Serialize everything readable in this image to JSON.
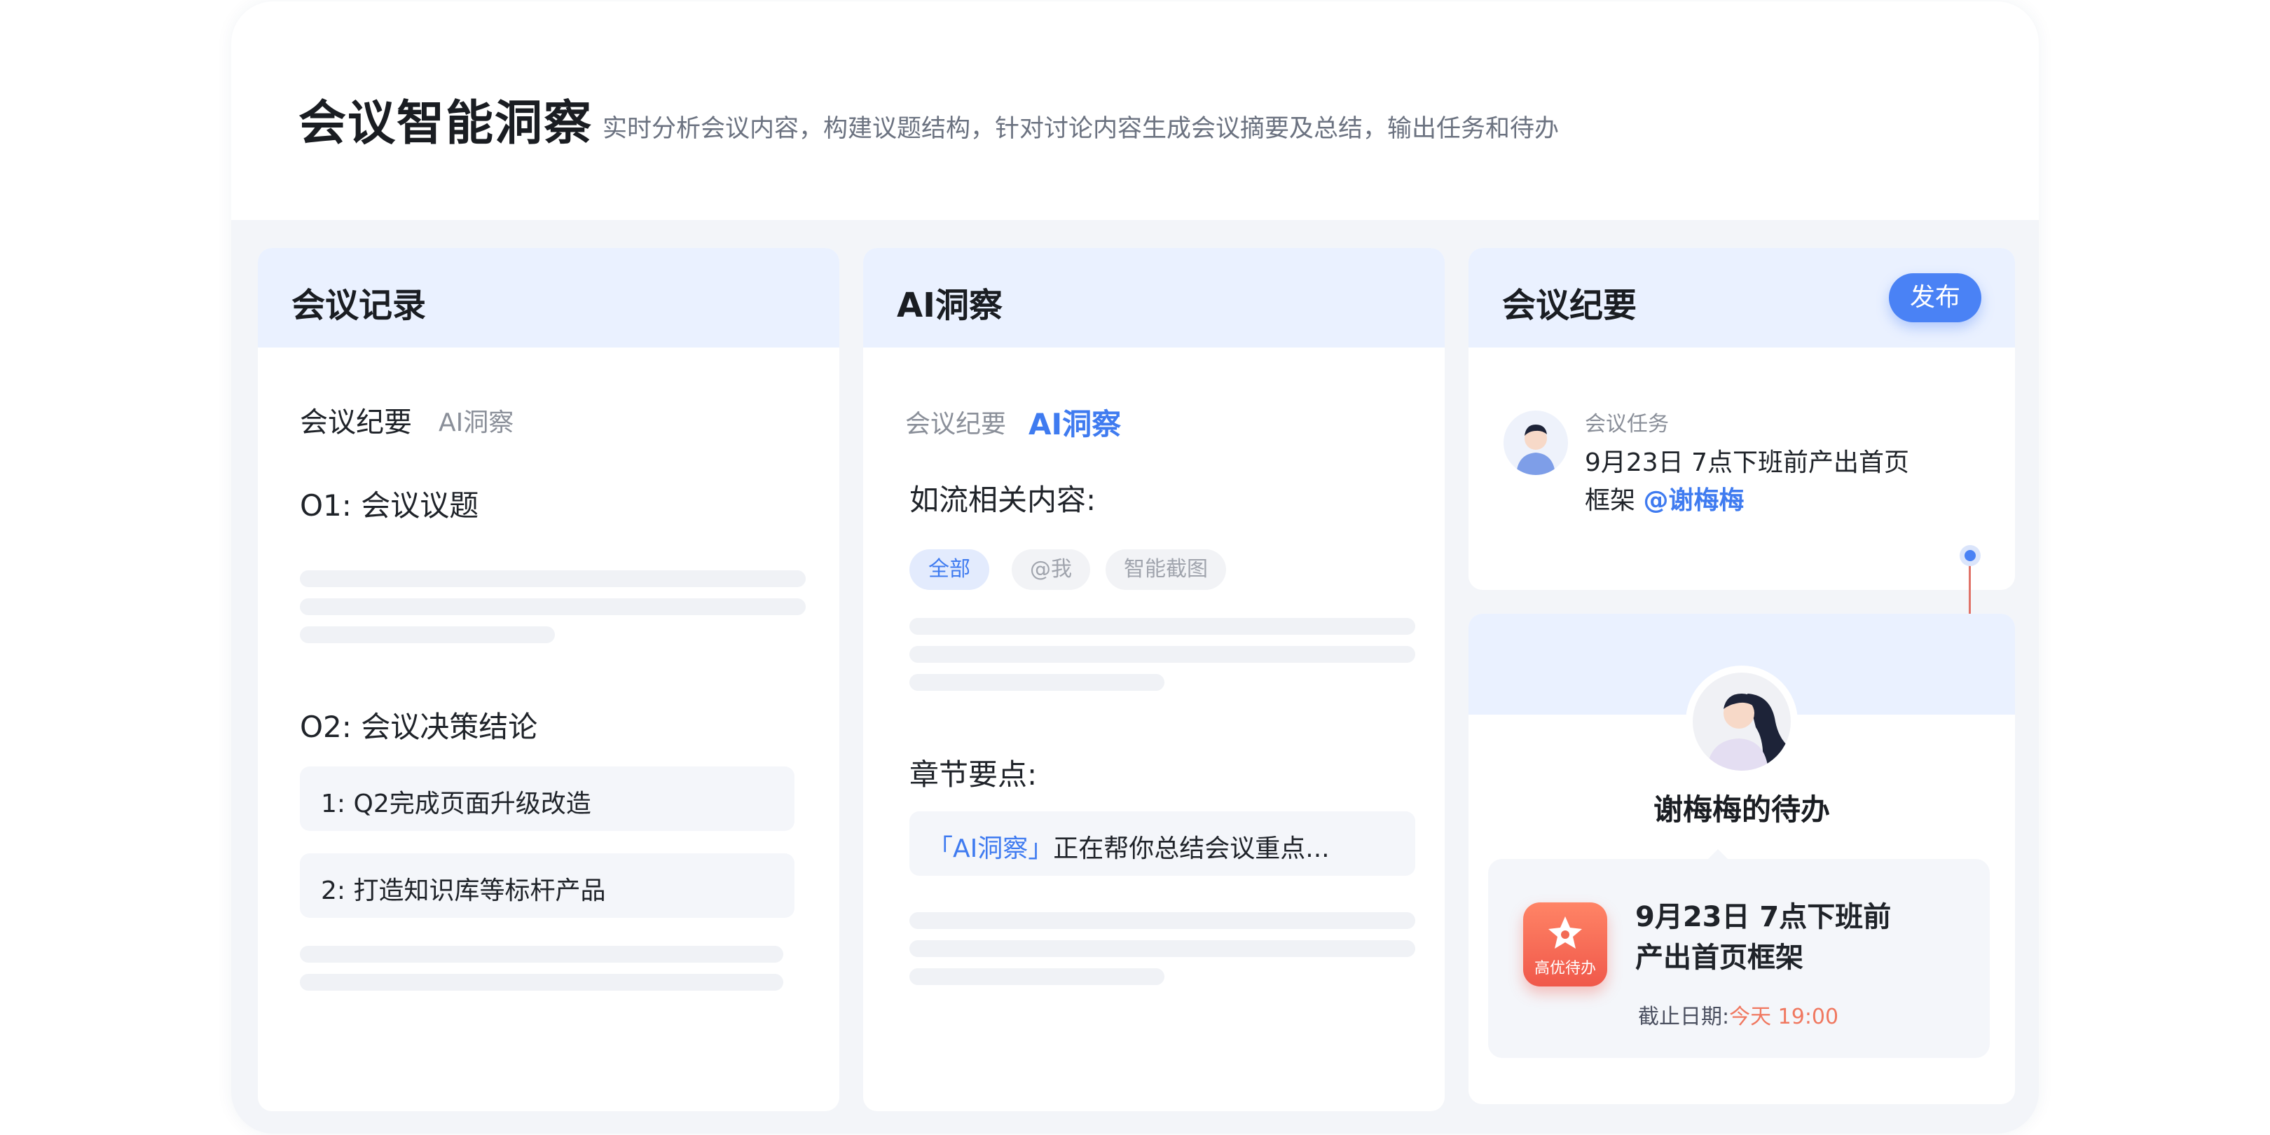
{
  "header": {
    "title": "会议智能洞察",
    "subtitle": "实时分析会议内容，构建议题结构，针对讨论内容生成会议摘要及总结，输出任务和待办"
  },
  "record": {
    "title": "会议记录",
    "tab_active": "会议纪要",
    "tab_other": "AI洞察",
    "section1": "O1: 会议议题",
    "section2": "O2: 会议决策结论",
    "items": [
      "1: Q2完成页面升级改造",
      "2: 打造知识库等标杆产品"
    ]
  },
  "insight": {
    "title": "AI洞察",
    "tab_other": "会议纪要",
    "tab_active": "AI洞察",
    "heading1": "如流相关内容:",
    "chips": [
      "全部",
      "@我",
      "智能截图"
    ],
    "heading2": "章节要点:",
    "highlight_tag": "「AI洞察」",
    "highlight_text": "正在帮你总结会议重点..."
  },
  "minutes": {
    "title": "会议纪要",
    "publish_label": "发布",
    "task_label": "会议任务",
    "task_text_line1": "9月23日 7点下班前产出首页",
    "task_text_line2": "框架",
    "task_mention": "@谢梅梅",
    "todo_title": "谢梅梅的待办",
    "todo_badge": "高优待办",
    "todo_line1": "9月23日 7点下班前",
    "todo_line2": "产出首页框架",
    "deadline_label": "截止日期:",
    "deadline_value": "今天 19:00"
  },
  "colors": {
    "accent": "#3f7bf0",
    "panel_header": "#eaf1ff",
    "badge": "#f26b55",
    "deadline": "#f07860"
  }
}
